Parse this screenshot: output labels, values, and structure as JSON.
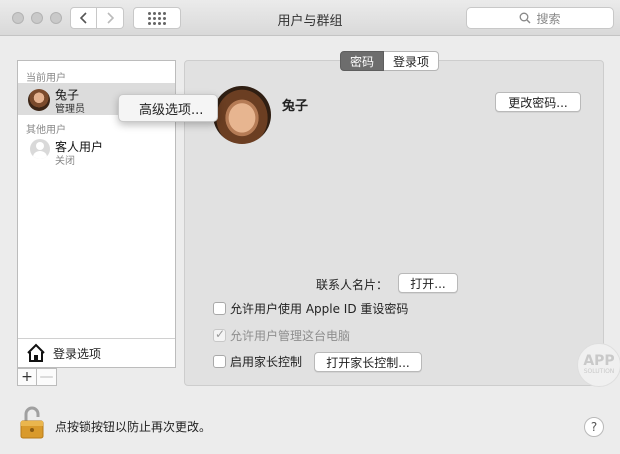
{
  "window": {
    "title": "用户与群组"
  },
  "toolbar": {
    "search_placeholder": "搜索",
    "back_icon": "chevron-left-icon",
    "forward_icon": "chevron-right-icon",
    "grid_icon": "show-all-grid-icon"
  },
  "sidebar": {
    "current_users_label": "当前用户",
    "other_users_label": "其他用户",
    "users": [
      {
        "name": "兔子",
        "role": "管理员"
      },
      {
        "name": "客人用户",
        "role": "关闭"
      }
    ],
    "login_options_label": "登录选项",
    "add_label": "+",
    "remove_label": "—"
  },
  "context_menu": {
    "items": [
      "高级选项..."
    ]
  },
  "tabs": [
    {
      "label": "密码",
      "active": true
    },
    {
      "label": "登录项",
      "active": false
    }
  ],
  "detail": {
    "user_name": "兔子",
    "change_password_label": "更改密码...",
    "contact_card_label": "联系人名片：",
    "open_label": "打开...",
    "checkboxes": [
      {
        "label": "允许用户使用 Apple ID 重设密码",
        "checked": false,
        "disabled": false
      },
      {
        "label": "允许用户管理这台电脑",
        "checked": true,
        "disabled": true
      },
      {
        "label": "启用家长控制",
        "checked": false,
        "disabled": false
      }
    ],
    "open_parental_controls_label": "打开家长控制..."
  },
  "watermark": {
    "line1": "APP",
    "line2": "SOLUTION"
  },
  "footer": {
    "lock_text": "点按锁按钮以防止再次更改。",
    "help_label": "?"
  }
}
